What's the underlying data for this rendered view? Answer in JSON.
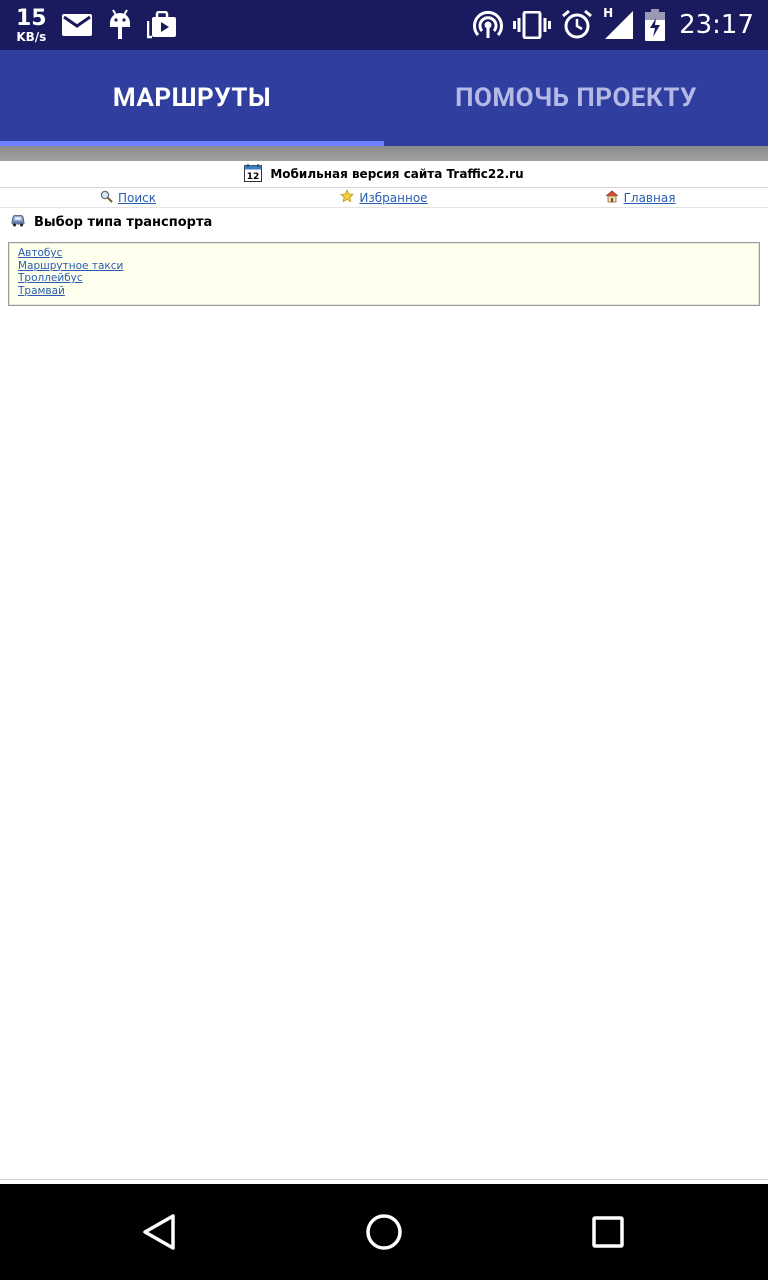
{
  "status_bar": {
    "net_speed": "15",
    "net_unit": "KB/s",
    "network_type": "H",
    "clock": "23:17",
    "icons": [
      "mail-icon",
      "android-debug-icon",
      "store-icon",
      "hotspot-icon",
      "vibrate-icon",
      "alarm-icon",
      "signal-icon",
      "battery-charging-icon"
    ]
  },
  "tabs": [
    {
      "label": "МАРШРУТЫ",
      "active": true
    },
    {
      "label": "ПОМОЧЬ ПРОЕКТУ",
      "active": false
    }
  ],
  "site": {
    "header": "Мобильная версия сайта Traffic22.ru",
    "calendar_day": "12",
    "nav": {
      "search": "Поиск",
      "favorites": "Избранное",
      "home": "Главная"
    },
    "section_title": "Выбор типа транспорта",
    "transport_types": [
      "Автобус",
      "Маршрутное такси",
      "Троллейбус",
      "Трамвай"
    ]
  },
  "colors": {
    "status_bar": "#1a1a5e",
    "app_bar": "#303f9f",
    "tab_indicator": "#6f7fff",
    "link": "#2a5db0",
    "box_background": "#ffffee"
  }
}
